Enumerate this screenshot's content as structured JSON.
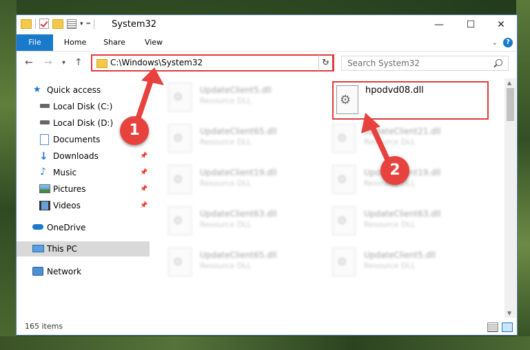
{
  "window": {
    "title": "System32",
    "controls": {
      "minimize": "—",
      "maximize": "☐",
      "close": "✕"
    }
  },
  "ribbon": {
    "tabs": [
      "File",
      "Home",
      "Share",
      "View"
    ],
    "help": "?"
  },
  "address": {
    "path": "C:\\Windows\\System32",
    "search_placeholder": "Search System32"
  },
  "sidebar": {
    "items": [
      {
        "label": "Quick access",
        "icon": "star-icon",
        "pinned": false
      },
      {
        "label": "Local Disk (C:)",
        "icon": "drive-icon",
        "pinned": false
      },
      {
        "label": "Local Disk (D:)",
        "icon": "drive-icon",
        "pinned": false
      },
      {
        "label": "Documents",
        "icon": "documents-icon",
        "pinned": true
      },
      {
        "label": "Downloads",
        "icon": "download-icon",
        "pinned": true
      },
      {
        "label": "Music",
        "icon": "music-icon",
        "pinned": true
      },
      {
        "label": "Pictures",
        "icon": "pictures-icon",
        "pinned": true
      },
      {
        "label": "Videos",
        "icon": "videos-icon",
        "pinned": true
      },
      {
        "label": "OneDrive",
        "icon": "cloud-icon",
        "pinned": false
      },
      {
        "label": "This PC",
        "icon": "pc-icon",
        "pinned": false,
        "selected": true
      },
      {
        "label": "Network",
        "icon": "network-icon",
        "pinned": false
      }
    ]
  },
  "files": [
    {
      "name": "UpdateClient5.dll",
      "type": "Resource DLL"
    },
    {
      "name": "hpodvd08.dll",
      "type": "",
      "highlighted": true
    },
    {
      "name": "UpdateClient65.dll",
      "type": "Resource DLL"
    },
    {
      "name": "UpdateClient21.dll",
      "type": "Resource DLL"
    },
    {
      "name": "UpdateClient19.dll",
      "type": "Resource DLL"
    },
    {
      "name": "UpdateClient19.dll",
      "type": "Resource DLL"
    },
    {
      "name": "UpdateClient63.dll",
      "type": "Resource DLL"
    },
    {
      "name": "UpdateClient63.dll",
      "type": "Resource DLL"
    },
    {
      "name": "UpdateClient65.dll",
      "type": "Resource DLL"
    },
    {
      "name": "UpdateClient5.dll",
      "type": "Resource DLL"
    }
  ],
  "status": {
    "item_count": "165 items"
  },
  "annotations": {
    "step1": "1",
    "step2": "2"
  },
  "colors": {
    "accent": "#1979ca",
    "highlight": "#e13a3a",
    "selected_bg": "#d9d9d9"
  }
}
